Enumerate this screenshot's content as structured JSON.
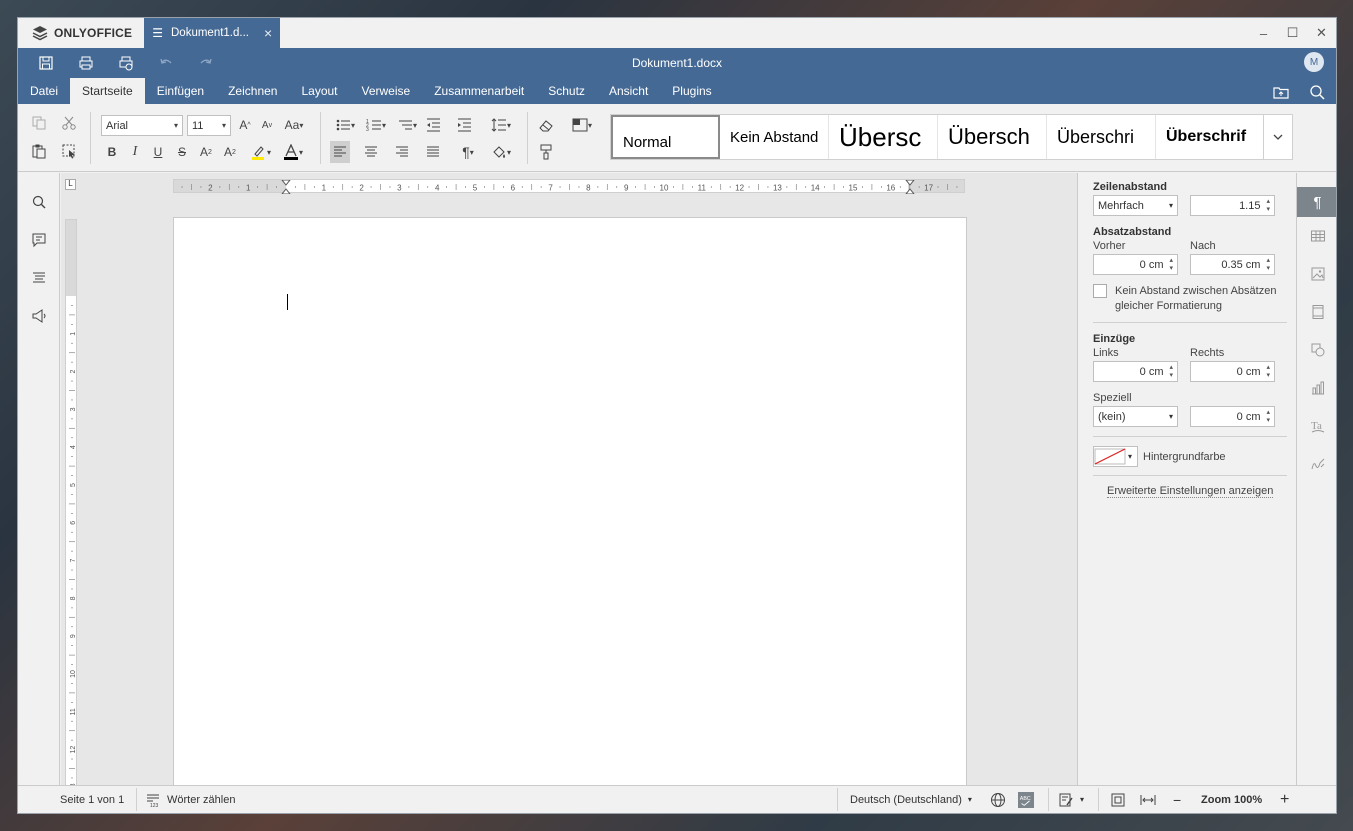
{
  "app": {
    "brand": "ONLYOFFICE",
    "tab_name": "Dokument1.d...",
    "doc_title": "Dokument1.docx",
    "avatar": "M"
  },
  "menu": [
    "Datei",
    "Startseite",
    "Einfügen",
    "Zeichnen",
    "Layout",
    "Verweise",
    "Zusammenarbeit",
    "Schutz",
    "Ansicht",
    "Plugins"
  ],
  "active_menu": "Startseite",
  "toolbar": {
    "font_name": "Arial",
    "font_size": "11"
  },
  "styles": [
    "Normal",
    "Kein Abstand",
    "Übersc",
    "Übersch",
    "Überschri",
    "Überschrif"
  ],
  "panel": {
    "line_spacing_title": "Zeilenabstand",
    "line_spacing_mode": "Mehrfach",
    "line_spacing_value": "1.15",
    "para_spacing_title": "Absatzabstand",
    "before_label": "Vorher",
    "before_value": "0 cm",
    "after_label": "Nach",
    "after_value": "0.35 cm",
    "no_space_label_1": "Kein Abstand zwischen Absätzen",
    "no_space_label_2": "gleicher Formatierung",
    "indents_title": "Einzüge",
    "left_label": "Links",
    "left_value": "0 cm",
    "right_label": "Rechts",
    "right_value": "0 cm",
    "special_label": "Speziell",
    "special_mode": "(kein)",
    "special_value": "0 cm",
    "bg_color_label": "Hintergrundfarbe",
    "advanced_link": "Erweiterte Einstellungen anzeigen"
  },
  "status": {
    "page_info": "Seite 1 von 1",
    "word_count": "Wörter zählen",
    "language": "Deutsch (Deutschland)",
    "zoom": "Zoom 100%"
  },
  "ruler_numbers_h": [
    "2",
    "1",
    "",
    "1",
    "2",
    "3",
    "4",
    "5",
    "6",
    "7",
    "8",
    "9",
    "10",
    "11",
    "12",
    "13",
    "14",
    "15",
    "16",
    "17"
  ],
  "ruler_numbers_v": [
    "1",
    "",
    "1",
    "2",
    "3",
    "4",
    "5",
    "6",
    "7",
    "8",
    "9",
    "10",
    "11",
    "12",
    "13"
  ],
  "colors": {
    "accent": "#446995",
    "panel_bg": "#f1f1f1",
    "doc_bg": "#e7e7e7"
  }
}
